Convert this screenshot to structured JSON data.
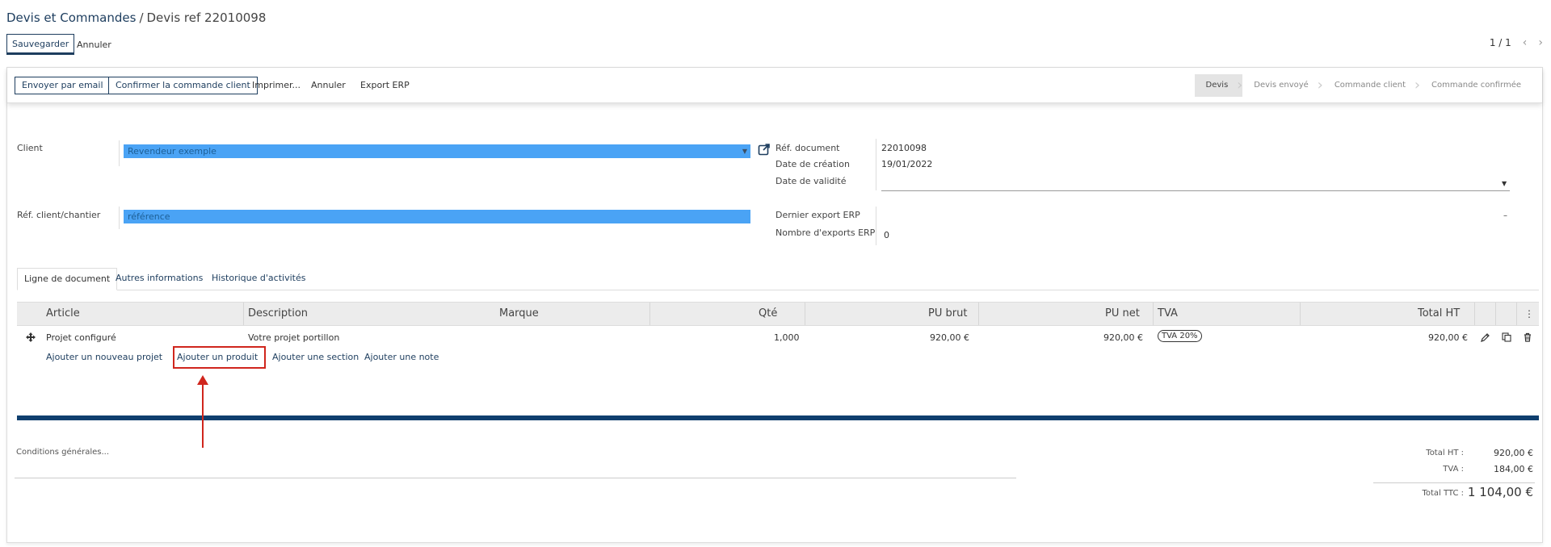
{
  "breadcrumb": {
    "root": "Devis et Commandes",
    "separator": "/",
    "current": "Devis ref 22010098"
  },
  "header_buttons": {
    "save": "Sauvegarder",
    "discard": "Annuler"
  },
  "pager": {
    "text": "1 / 1",
    "prev": "‹",
    "next": "›"
  },
  "actions": {
    "send_email": "Envoyer par email",
    "confirm_order": "Confirmer la commande client",
    "print": "Imprimer...",
    "cancel": "Annuler",
    "export_erp": "Export ERP"
  },
  "stages": [
    {
      "label": "Devis",
      "active": true
    },
    {
      "label": "Devis envoyé",
      "active": false
    },
    {
      "label": "Commande client",
      "active": false
    },
    {
      "label": "Commande confirmée",
      "active": false
    }
  ],
  "form": {
    "client": {
      "label": "Client",
      "value": "Revendeur exemple"
    },
    "ref_client": {
      "label": "Réf. client/chantier",
      "value": "référence"
    },
    "ref_document": {
      "label": "Réf. document",
      "value": "22010098"
    },
    "date_creation": {
      "label": "Date de création",
      "value": "19/01/2022"
    },
    "date_validite": {
      "label": "Date de validité",
      "value": ""
    },
    "dernier_export": {
      "label": "Dernier export ERP",
      "value": ""
    },
    "nb_exports": {
      "label": "Nombre d'exports ERP",
      "value": "0"
    }
  },
  "tabs": [
    {
      "label": "Ligne de document",
      "active": true
    },
    {
      "label": "Autres informations",
      "active": false
    },
    {
      "label": "Historique d'activités",
      "active": false
    }
  ],
  "table": {
    "headers": [
      "Article",
      "Description",
      "Marque",
      "Qté",
      "PU brut",
      "PU net",
      "TVA",
      "Total HT"
    ],
    "rows": [
      {
        "article": "Projet configuré",
        "description": "Votre projet portillon",
        "marque": "",
        "qte": "1,000",
        "pu_brut": "920,00 €",
        "pu_net": "920,00 €",
        "tva": "TVA 20%",
        "total_ht": "920,00 €"
      }
    ],
    "add_links": {
      "add_project": "Ajouter un nouveau projet",
      "add_product": "Ajouter un produit",
      "add_section": "Ajouter une section",
      "add_note": "Ajouter une note"
    }
  },
  "footer": {
    "conditions_placeholder": "Conditions générales...",
    "total_ht_label": "Total HT :",
    "total_ht_value": "920,00 €",
    "tva_label": "TVA :",
    "tva_value": "184,00 €",
    "total_ttc_label": "Total TTC :",
    "total_ttc_value": "1 104,00 €"
  },
  "colors": {
    "primary": "#1d3d5e",
    "highlight_input": "#4aa3f5",
    "annotation_red": "#d0261d",
    "bar_blue": "#0f3f6e"
  }
}
